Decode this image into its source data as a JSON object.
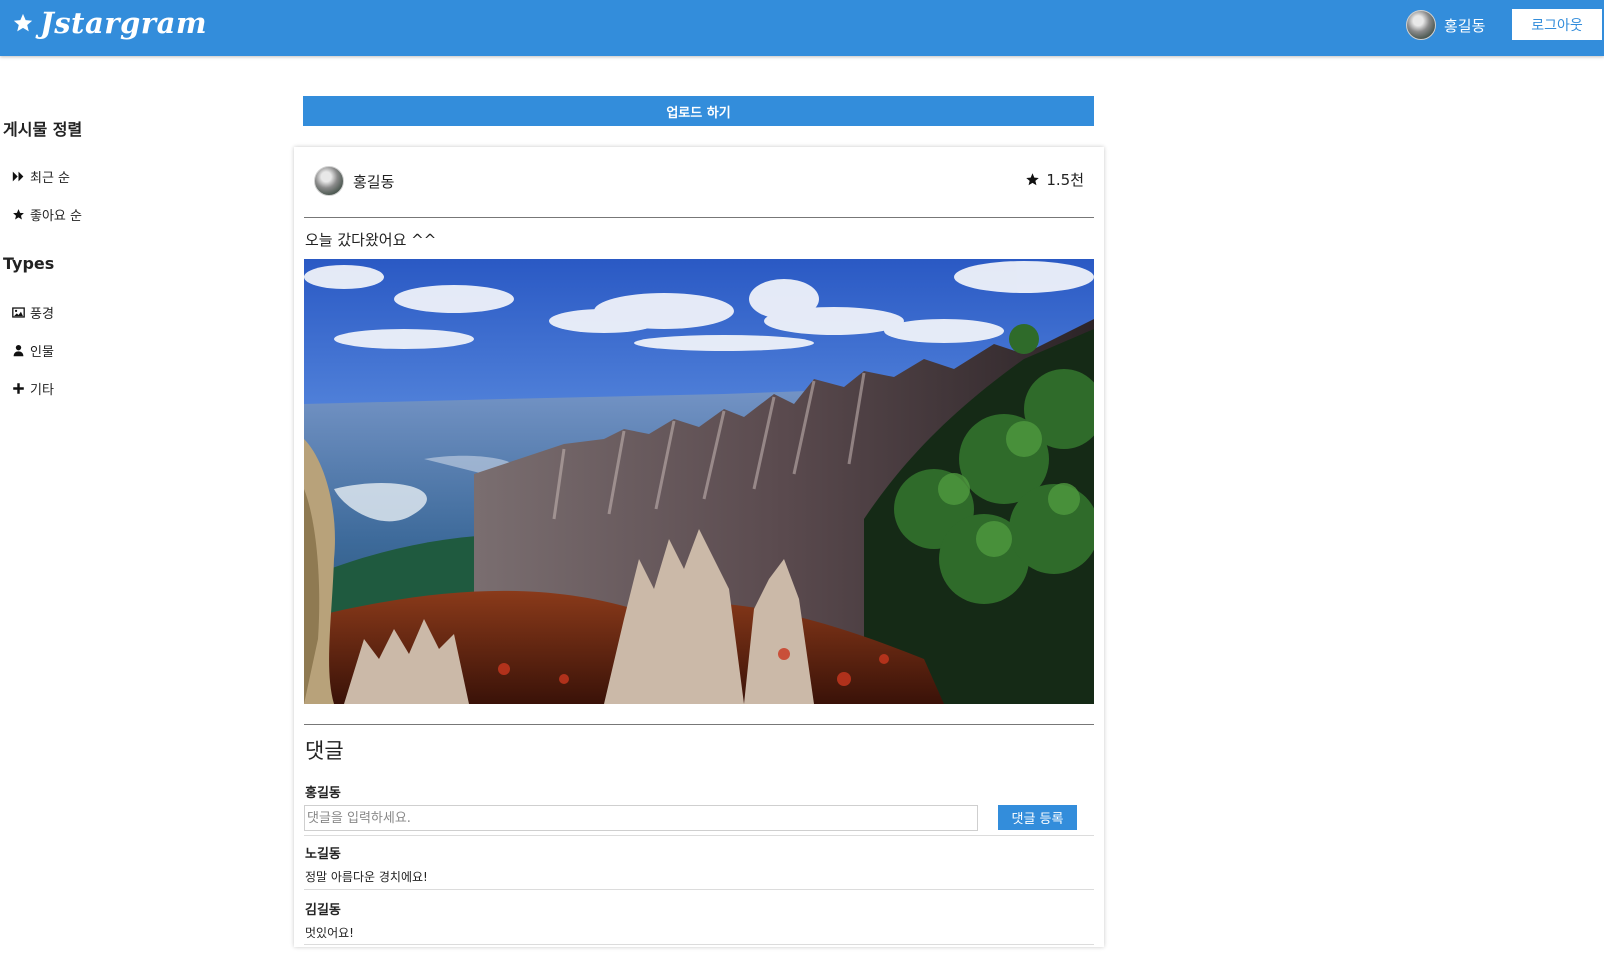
{
  "header": {
    "brand": "Jstargram",
    "user_name": "홍길동",
    "logout_label": "로그아웃",
    "accent_color": "#338ddb"
  },
  "sidebar": {
    "sort_heading": "게시물 정렬",
    "sort_items": [
      {
        "icon": "fast-forward-icon",
        "label": "최근 순"
      },
      {
        "icon": "star-icon",
        "label": "좋아요 순"
      }
    ],
    "types_heading": "Types",
    "type_items": [
      {
        "icon": "image-icon",
        "label": "풍경"
      },
      {
        "icon": "user-icon",
        "label": "인물"
      },
      {
        "icon": "plus-icon",
        "label": "기타"
      }
    ]
  },
  "upload": {
    "label": "업로드 하기"
  },
  "post": {
    "author": "홍길동",
    "likes": "1.5천",
    "caption": "오늘 갔다왔어요 ^^",
    "photo_icon": "mountain-landscape-photo",
    "comments_title": "댓글",
    "comment_form": {
      "author": "홍길동",
      "placeholder": "댓글을 입력하세요.",
      "submit_label": "댓글 등록"
    },
    "comments": [
      {
        "author": "노길동",
        "text": "정말 아름다운 경치에요!"
      },
      {
        "author": "김길동",
        "text": "멋있어요!"
      }
    ]
  }
}
